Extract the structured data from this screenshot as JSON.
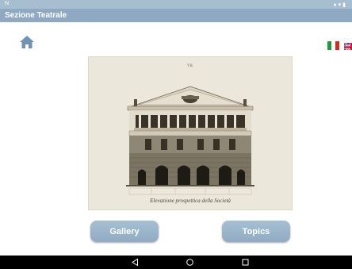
{
  "status_bar": {
    "left_text": "N"
  },
  "app_bar": {
    "title": "Sezione Teatrale"
  },
  "icons": {
    "home": "home-icon",
    "back": "back-triangle-icon",
    "home_nav": "home-circle-icon",
    "recents": "recents-square-icon"
  },
  "flags": [
    "flag-italy",
    "flag-uk"
  ],
  "picture": {
    "plate_number": "VII.",
    "caption": "Elevazione prospettica della Società"
  },
  "buttons": {
    "gallery": "Gallery",
    "topics": "Topics"
  },
  "colors": {
    "status_bar": "#a7bdd0",
    "app_bar": "#8ea9c1",
    "button": "#9bb5ca",
    "home_icon": "#6f93b4",
    "nav_bar": "#000000"
  }
}
